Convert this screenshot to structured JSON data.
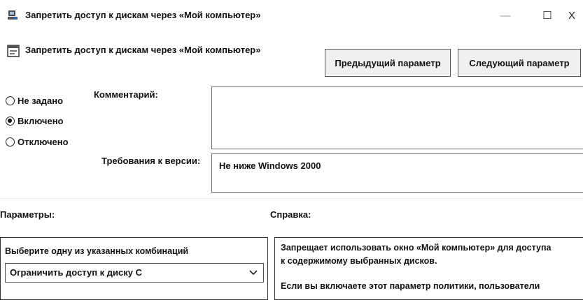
{
  "window": {
    "title": "Запретить доступ к дискам через «Мой компьютер»",
    "minimize": "—",
    "maximize": "☐",
    "close": "X"
  },
  "policy": {
    "name": "Запретить доступ к дискам через «Мой компьютер»",
    "prev_button": "Предыдущий параметр",
    "next_button": "Следующий параметр"
  },
  "state_options": [
    {
      "label": "Не задано",
      "checked": false
    },
    {
      "label": "Включено",
      "checked": true
    },
    {
      "label": "Отключено",
      "checked": false
    }
  ],
  "comment": {
    "label": "Комментарий:",
    "value": ""
  },
  "requirements": {
    "label": "Требования к версии:",
    "value": "Не ниже Windows 2000"
  },
  "parameters": {
    "label": "Параметры:",
    "combo_caption": "Выберите одну из указанных комбинаций",
    "selected": "Ограничить доступ к диску С"
  },
  "help": {
    "label": "Справка:",
    "line1": "Запрещает использовать окно «Мой компьютер» для доступа",
    "line2": "к содержимому выбранных дисков.",
    "line3": "Если вы включаете этот параметр политики, пользователи"
  }
}
